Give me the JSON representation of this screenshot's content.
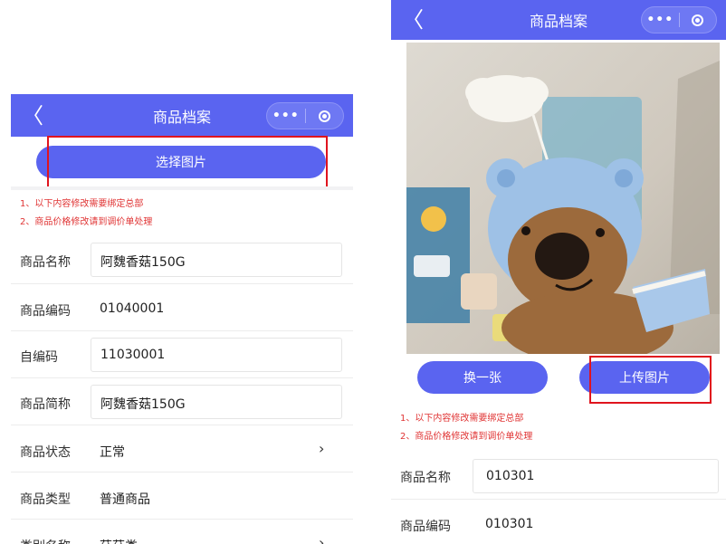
{
  "left": {
    "nav": {
      "back": "〈",
      "title": "商品档案",
      "more": "•••"
    },
    "select_button": "选择图片",
    "notes": [
      "1、以下内容修改需要绑定总部",
      "2、商品价格修改请到调价单处理"
    ],
    "fields": [
      {
        "label": "商品名称",
        "value": "阿魏香菇150G",
        "type": "input"
      },
      {
        "label": "商品编码",
        "value": "01040001",
        "type": "text"
      },
      {
        "label": "自编码",
        "value": "11030001",
        "type": "input"
      },
      {
        "label": "商品简称",
        "value": "阿魏香菇150G",
        "type": "input"
      },
      {
        "label": "商品状态",
        "value": "正常",
        "type": "select",
        "chevron": "›"
      },
      {
        "label": "商品类型",
        "value": "普通商品",
        "type": "text"
      },
      {
        "label": "类别名称",
        "value": "菇菇类",
        "type": "select",
        "chevron": "›"
      }
    ]
  },
  "right": {
    "nav": {
      "back": "〈",
      "title": "商品档案",
      "more": "•••"
    },
    "change_button": "换一张",
    "upload_button": "上传图片",
    "notes": [
      "1、以下内容修改需要绑定总部",
      "2、商品价格修改请到调价单处理"
    ],
    "fields": [
      {
        "label": "商品名称",
        "value": "010301",
        "type": "input"
      },
      {
        "label": "商品编码",
        "value": "010301",
        "type": "text"
      }
    ]
  },
  "colors": {
    "primary": "#5a64f0",
    "highlight": "#e0141e",
    "note": "#e03434"
  }
}
